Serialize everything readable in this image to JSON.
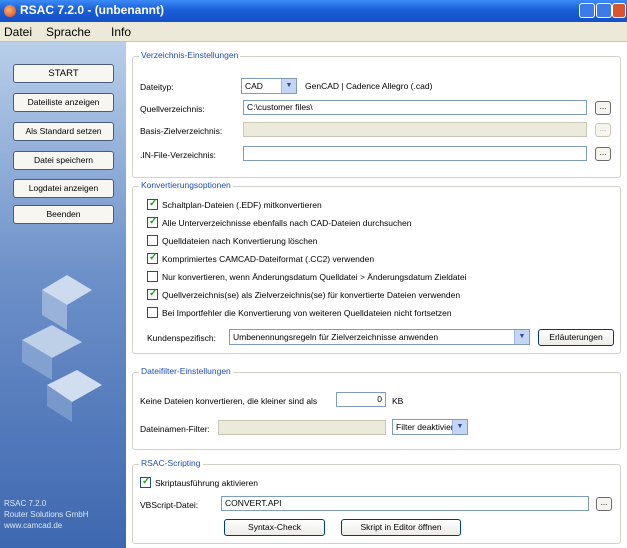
{
  "window": {
    "title": "RSAC 7.2.0 - (unbenannt)"
  },
  "menu": [
    "Datei",
    "Sprache",
    "Info"
  ],
  "sidebar": {
    "buttons": [
      "START",
      "Dateiliste anzeigen",
      "Als Standard setzen",
      "Datei speichern",
      "Logdatei anzeigen",
      "Beenden"
    ],
    "footer": [
      "RSAC 7.2.0",
      "Router Solutions GmbH",
      "www.camcad.de"
    ]
  },
  "directory_settings": {
    "title": "Verzeichnis-Einstellungen",
    "filetype_label": "Dateityp:",
    "filetype_value": "CAD",
    "filetype_description": "GenCAD | Cadence Allegro (.cad)",
    "source_label": "Quellverzeichnis:",
    "source_value": "C:\\customer files\\",
    "base_target_label": "Basis-Zielverzeichnis:",
    "base_target_value": "",
    "infile_label": ".IN-File-Verzeichnis:",
    "infile_value": "",
    "browse_label": "..."
  },
  "conversion_options": {
    "title": "Konvertierungsoptionen",
    "checkboxes": [
      {
        "label": "Schaltplan-Dateien (.EDF) mitkonvertieren",
        "checked": true
      },
      {
        "label": "Alle Unterverzeichnisse ebenfalls nach CAD-Dateien durchsuchen",
        "checked": true
      },
      {
        "label": "Quelldateien nach Konvertierung löschen",
        "checked": false
      },
      {
        "label": "Komprimiertes CAMCAD-Dateiformat (.CC2) verwenden",
        "checked": true
      },
      {
        "label": "Nur konvertieren, wenn Änderungsdatum Quelldatei > Änderungsdatum Zieldatei",
        "checked": false
      },
      {
        "label": "Quellverzeichnis(se) als Zielverzeichnis(se) für konvertierte Dateien verwenden",
        "checked": true
      },
      {
        "label": "Bei Importfehler die Konvertierung von weiteren Quelldateien nicht fortsetzen",
        "checked": false
      }
    ],
    "customer_label": "Kundenspezifisch:",
    "customer_value": "Umbenennungsregeln für Zielverzeichnisse anwenden",
    "explain_button": "Erläuterungen"
  },
  "file_filter": {
    "title": "Dateifilter-Einstellungen",
    "min_size_label": "Keine Dateien konvertieren, die kleiner sind als",
    "min_size_value": "0",
    "min_size_unit": "KB",
    "name_filter_label": "Dateinamen-Filter:",
    "name_filter_value": "",
    "filter_state": "Filter deaktiviert"
  },
  "scripting": {
    "title": "RSAC-Scripting",
    "enable_label": "Skriptausführung aktivieren",
    "enabled": true,
    "vbscript_label": "VBScript-Datei:",
    "vbscript_value": "CONVERT.API",
    "syntax_button": "Syntax-Check",
    "open_editor_button": "Skript in Editor öffnen"
  }
}
